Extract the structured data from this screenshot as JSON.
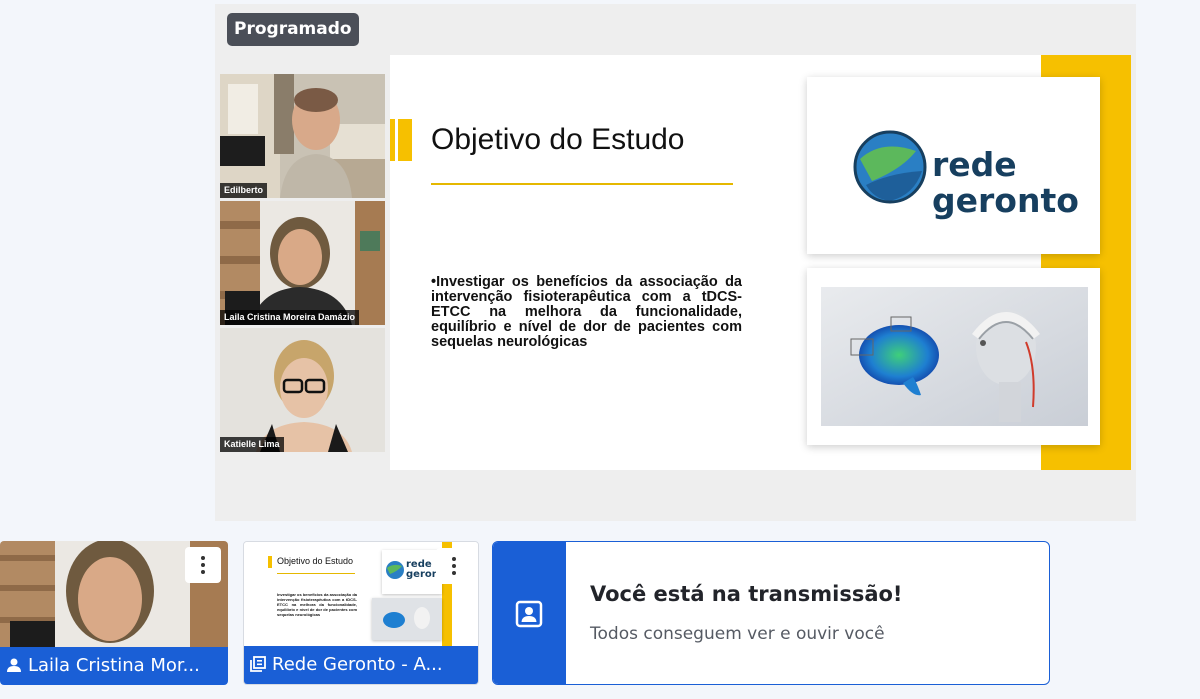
{
  "stage": {
    "badge": "Programado",
    "participants": [
      {
        "name": "Edilberto"
      },
      {
        "name": "Laila Cristina Moreira Damázio"
      },
      {
        "name": "Katielle Lima"
      }
    ]
  },
  "slide": {
    "title": "Objetivo do Estudo",
    "body": "•Investigar os benefícios da associação da intervenção fisioterapêutica com a tDCS-ETCC na melhora da funcionalidade, equilíbrio e nível de dor de pacientes com sequelas neurológicas",
    "logo_line1": "rede",
    "logo_line2": "geronto"
  },
  "tiles": {
    "camera_label": "Laila Cristina Mor...",
    "screen_label": "Rede Geronto - A...",
    "mini_title": "Objetivo do Estudo",
    "mini_body": "Investigar os benefícios da associação da intervenção fisioterapêutica com a tDCS-ETCC na melhora da funcionalidade, equilíbrio e nível de dor de pacientes com sequelas neurológicas",
    "mini_logo_1": "rede",
    "mini_logo_2": "geront"
  },
  "notice": {
    "title": "Você está na transmissão!",
    "subtitle": "Todos conseguem ver e ouvir você"
  },
  "colors": {
    "accent_blue": "#1a5fd6",
    "slide_yellow": "#f6c000",
    "badge_bg": "#4b4f58"
  }
}
